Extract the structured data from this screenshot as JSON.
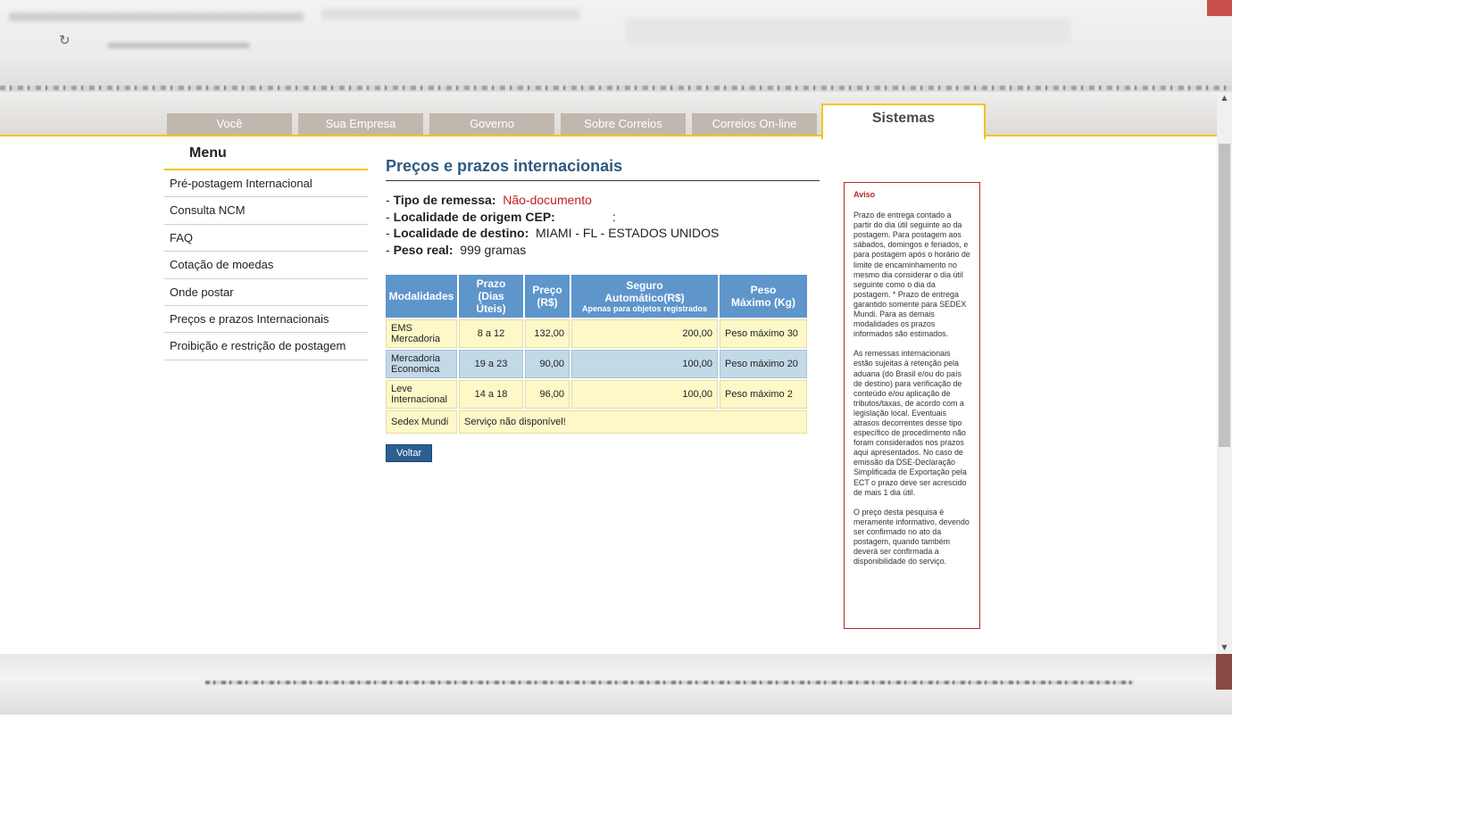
{
  "tabs": [
    {
      "label": "Você"
    },
    {
      "label": "Sua Empresa"
    },
    {
      "label": "Governo"
    },
    {
      "label": "Sobre Correios"
    },
    {
      "label": "Correios On-line"
    },
    {
      "label": "Sistemas"
    }
  ],
  "menu": {
    "title": "Menu",
    "items": [
      {
        "label": "Pré-postagem Internacional"
      },
      {
        "label": "Consulta NCM"
      },
      {
        "label": "FAQ"
      },
      {
        "label": "Cotação de moedas"
      },
      {
        "label": "Onde postar"
      },
      {
        "label": "Preços e prazos Internacionais"
      },
      {
        "label": "Proibição e restrição de postagem"
      }
    ]
  },
  "main": {
    "title": "Preços e prazos internacionais",
    "info": {
      "tipo_label": "Tipo de remessa:",
      "tipo_value": "Não-documento",
      "origem_label": "Localidade de origem CEP:",
      "origem_value": ":",
      "destino_label": "Localidade de destino:",
      "destino_value": "MIAMI - FL - ESTADOS UNIDOS",
      "peso_label": "Peso real:",
      "peso_value": "999 gramas"
    },
    "table": {
      "headers": {
        "modalidades": "Modalidades",
        "prazo": "Prazo",
        "prazo_sub": "(Dias Úteis)",
        "preco": "Preço",
        "preco_sub": "(R$)",
        "seguro": "Seguro",
        "seguro_sub": "Automático(R$)",
        "seguro_note": "Apenas para objetos registrados",
        "peso": "Peso",
        "peso_sub": "Máximo (Kg)"
      },
      "rows": [
        {
          "mod1": "EMS",
          "mod2": "Mercadoria",
          "prazo": "8 a 12",
          "preco": "132,00",
          "seguro": "200,00",
          "peso": "Peso máximo 30"
        },
        {
          "mod1": "Mercadoria",
          "mod2": "Economica",
          "prazo": "19 a 23",
          "preco": "90,00",
          "seguro": "100,00",
          "peso": "Peso máximo 20"
        },
        {
          "mod1": "Leve",
          "mod2": "Internacional",
          "prazo": "14 a 18",
          "preco": "96,00",
          "seguro": "100,00",
          "peso": "Peso máximo 2"
        }
      ],
      "sedex": {
        "mod": "Sedex Mundi",
        "message": "Serviço não disponível!"
      }
    },
    "back_label": "Voltar"
  },
  "notice": {
    "title": "Aviso",
    "p1": "Prazo de entrega contado a partir do dia útil seguinte ao da postagem. Para postagem aos sábados, domingos e feriados, e para postagem após o horário de limite de encaminhamento no mesmo dia considerar o dia útil seguinte como o dia da postagem. * Prazo de entrega garantido somente para SEDEX Mundi. Para as demais modalidades os prazos informados são estimados.",
    "p2": "As remessas internacionais estão sujeitas à retenção pela aduana (do Brasil e/ou do país de destino) para verificação de conteúdo e/ou aplicação de tributos/taxas, de acordo com a legislação local. Eventuais atrasos decorrentes desse tipo específico de procedimento não foram considerados nos prazos aqui apresentados. No caso de emissão da DSE-Declaração Simplificada de Exportação pela ECT o prazo deve ser acrescido de mais 1 dia útil.",
    "p3": "O preço desta pesquisa é meramente informativo, devendo ser confirmado no ato da postagem, quando também deverá ser confirmada a disponibilidade do serviço."
  },
  "icons": {
    "reload": "reload-icon",
    "scroll_up": "scroll-up-arrow-icon",
    "scroll_down": "scroll-down-arrow-icon"
  },
  "colors": {
    "accent_yellow": "#f2c413",
    "title_blue": "#2e5a80",
    "header_blue": "#5e95cb",
    "row_yellow": "#fdf8c8",
    "row_blue": "#c2d9e8",
    "alert_red": "#b02a2a"
  }
}
